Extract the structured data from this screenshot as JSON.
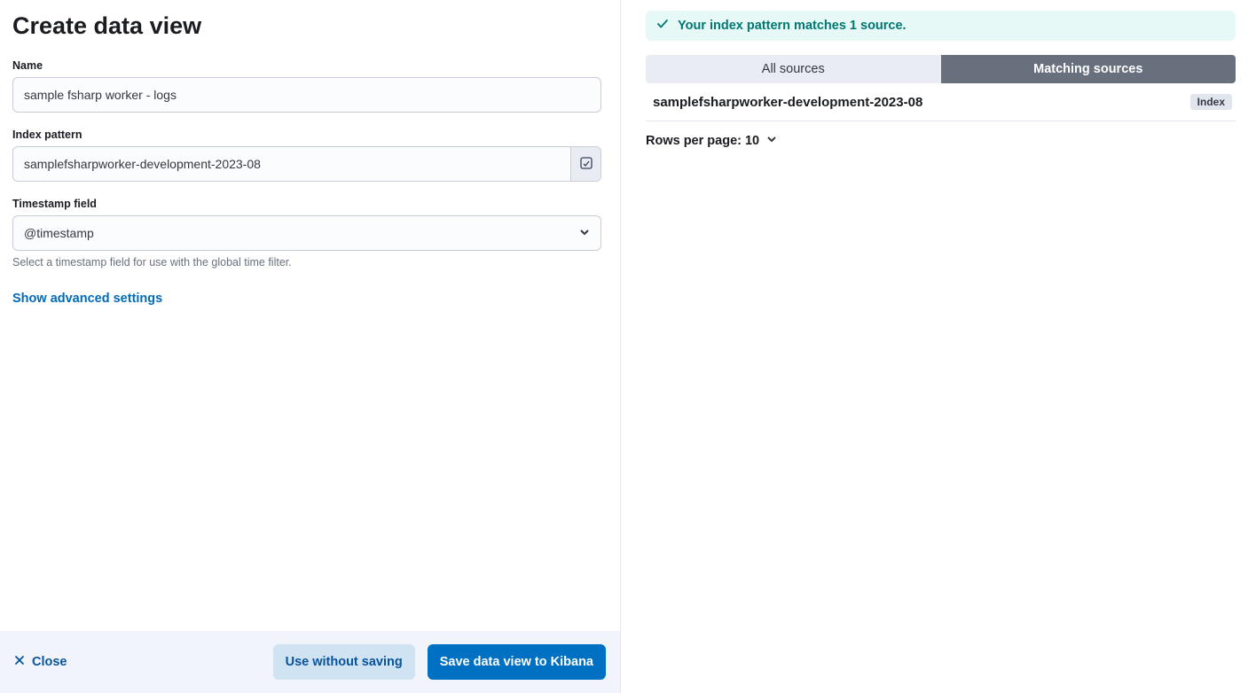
{
  "title": "Create data view",
  "form": {
    "name_label": "Name",
    "name_value": "sample fsharp worker - logs",
    "pattern_label": "Index pattern",
    "pattern_value": "samplefsharpworker-development-2023-08",
    "ts_label": "Timestamp field",
    "ts_value": "@timestamp",
    "ts_help": "Select a timestamp field for use with the global time filter.",
    "advanced_link": "Show advanced settings"
  },
  "footer": {
    "close": "Close",
    "use_without": "Use without saving",
    "save": "Save data view to Kibana"
  },
  "right": {
    "callout": "Your index pattern matches 1 source.",
    "tab_all": "All sources",
    "tab_matching": "Matching sources",
    "row_name": "samplefsharpworker-development-2023-08",
    "row_badge": "Index",
    "rows_per_page": "Rows per page: 10"
  }
}
